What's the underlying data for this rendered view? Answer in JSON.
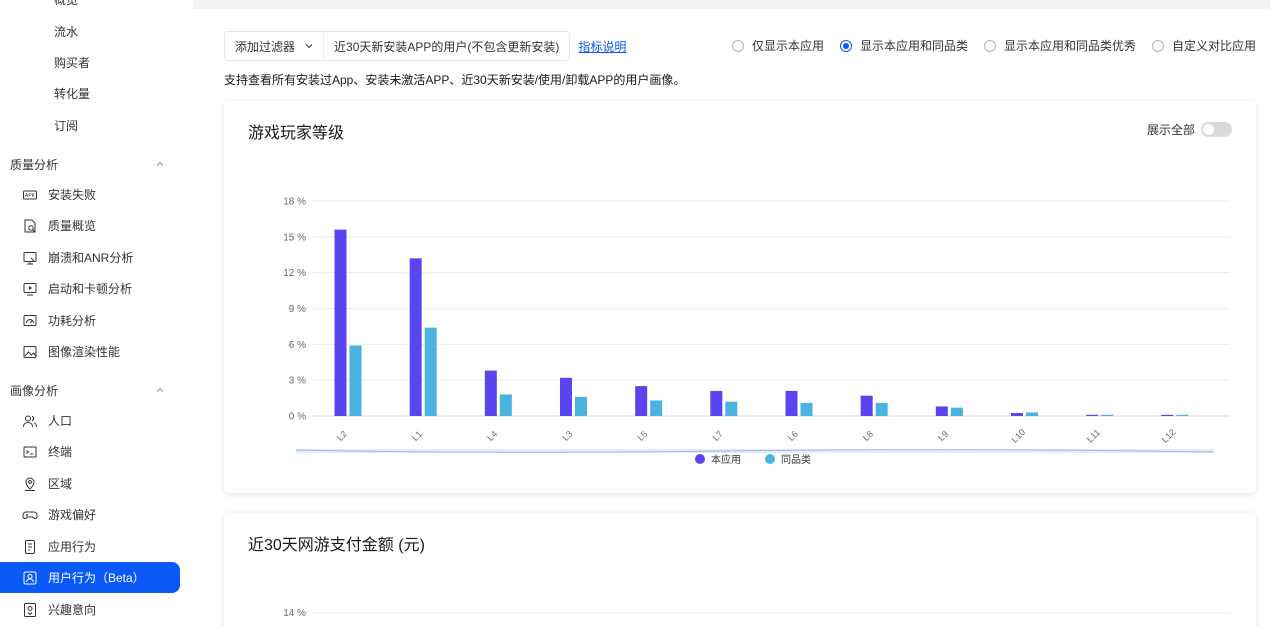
{
  "sidebar": {
    "top_cut_item": "概览",
    "sub_items": [
      "流水",
      "购买者",
      "转化量",
      "订阅"
    ],
    "quality_group": "质量分析",
    "quality_items": [
      {
        "label": "安装失败",
        "icon": "apk-icon"
      },
      {
        "label": "质量概览",
        "icon": "document-search-icon"
      },
      {
        "label": "崩溃和ANR分析",
        "icon": "crash-icon"
      },
      {
        "label": "启动和卡顿分析",
        "icon": "startup-icon"
      },
      {
        "label": "功耗分析",
        "icon": "gauge-icon"
      },
      {
        "label": "图像渲染性能",
        "icon": "image-icon"
      }
    ],
    "portrait_group": "画像分析",
    "portrait_items": [
      {
        "label": "人口",
        "icon": "people-icon"
      },
      {
        "label": "终端",
        "icon": "terminal-icon"
      },
      {
        "label": "区域",
        "icon": "location-icon"
      },
      {
        "label": "游戏偏好",
        "icon": "gamepad-icon"
      },
      {
        "label": "应用行为",
        "icon": "app-icon"
      },
      {
        "label": "用户行为（Beta）",
        "icon": "user-behavior-icon",
        "active": true
      },
      {
        "label": "兴趣意向",
        "icon": "interest-icon"
      }
    ]
  },
  "filter": {
    "add_label": "添加过滤器",
    "tag": "近30天新安装APP的用户(不包含更新安装)",
    "help_link": "指标说明"
  },
  "radios": [
    {
      "label": "仅显示本应用",
      "checked": false
    },
    {
      "label": "显示本应用和同品类",
      "checked": true
    },
    {
      "label": "显示本应用和同品类优秀",
      "checked": false
    },
    {
      "label": "自定义对比应用",
      "checked": false
    }
  ],
  "description": "支持查看所有安装过App、安装未激活APP、近30天新安装/使用/卸载APP的用户画像。",
  "card1": {
    "title": "游戏玩家等级",
    "toggle_label": "展示全部"
  },
  "card2": {
    "title": "近30天网游支付金额 (元)",
    "first_tick": "14 %"
  },
  "chart_data": {
    "type": "bar",
    "categories": [
      "L2",
      "L1",
      "L4",
      "L3",
      "L5",
      "L7",
      "L6",
      "L8",
      "L9",
      "L10",
      "L11",
      "L12"
    ],
    "series": [
      {
        "name": "本应用",
        "color": "#5b45f0",
        "values": [
          15.6,
          13.2,
          3.8,
          3.2,
          2.5,
          2.1,
          2.1,
          1.7,
          0.8,
          0.25,
          0.1,
          0.1
        ]
      },
      {
        "name": "同品类",
        "color": "#4bb3e0",
        "values": [
          5.9,
          7.4,
          1.8,
          1.6,
          1.3,
          1.2,
          1.1,
          1.1,
          0.7,
          0.3,
          0.1,
          0.1
        ]
      }
    ],
    "y_ticks": [
      "0 %",
      "3 %",
      "6 %",
      "9 %",
      "12 %",
      "15 %",
      "18 %"
    ],
    "ylim": [
      0,
      18
    ],
    "legend": "bottom"
  }
}
